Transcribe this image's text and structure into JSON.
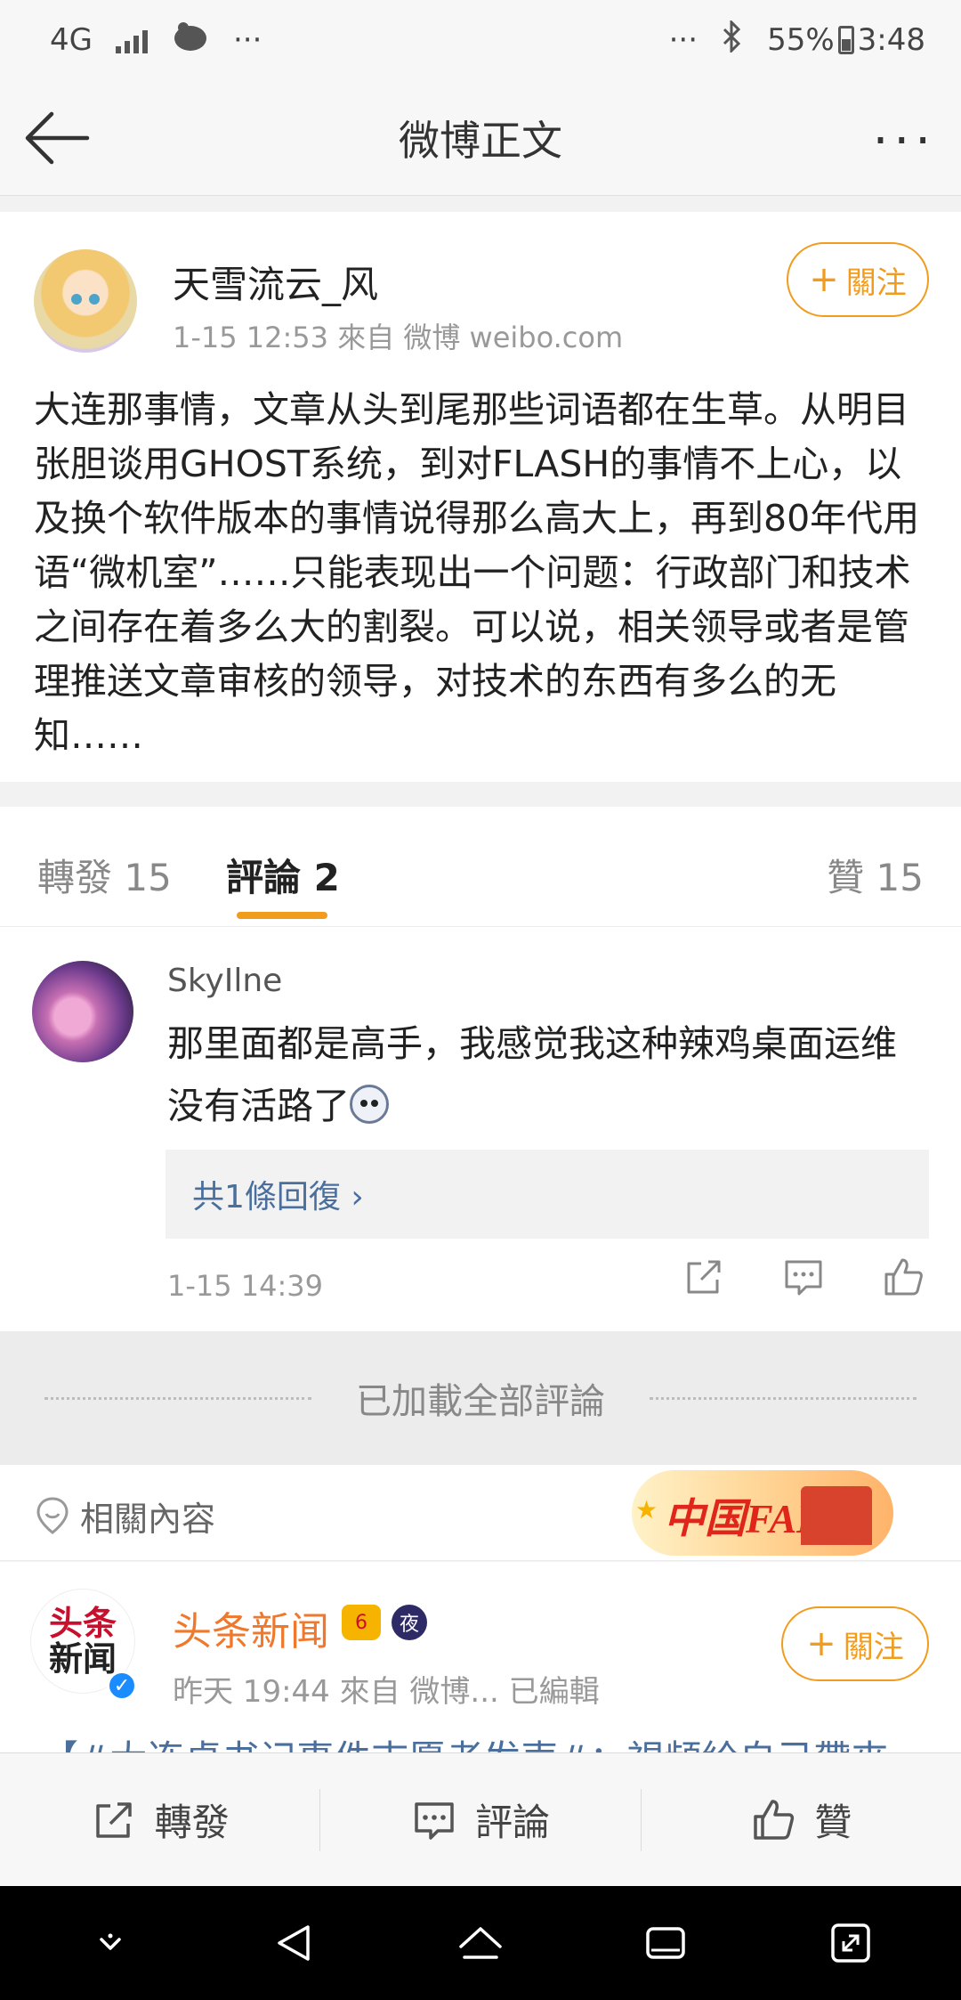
{
  "status_bar": {
    "network": "4G",
    "more_left": "···",
    "more_right": "···",
    "battery": "55%",
    "time": "3:48"
  },
  "nav": {
    "title": "微博正文",
    "more": "···"
  },
  "post": {
    "author": "天雪流云_风",
    "meta": "1-15 12:53   來自 微博 weibo.com",
    "follow_label": "關注",
    "follow_plus": "+",
    "text": "大连那事情，文章从头到尾那些词语都在生草。从明目张胆谈用GHOST系统，到对FLASH的事情不上心，以及换个软件版本的事情说得那么高大上，再到80年代用语“微机室”……只能表现出一个问题：行政部门和技术之间存在着多么大的割裂。可以说，相关领导或者是管理推送文章审核的领导，对技术的东西有多么的无知……"
  },
  "tabs": {
    "repost": "轉發 15",
    "comment": "評論 2",
    "like": "贊 15"
  },
  "comment": {
    "user": "SkyIlne",
    "text": "那里面都是高手，我感觉我这种辣鸡桌面运维没有活路了",
    "replies": "共1條回復 ›",
    "time": "1-15 14:39"
  },
  "loaded_label": "已加載全部評論",
  "related": {
    "label": "相關內容",
    "badge_text": "中国FANS"
  },
  "news": {
    "avatar_line1": "头条",
    "avatar_line2": "新闻",
    "author": "头条新闻",
    "crown_badge": "6",
    "night_badge": "夜",
    "meta": "昨天 19:44   來自 微博...   已編輯",
    "follow_label": "關注",
    "follow_plus": "+",
    "peek": "【#大连桌书记事件志愿者发声#：視頻給自己帶來"
  },
  "action_bar": {
    "repost": "轉發",
    "comment": "評論",
    "like": "贊"
  },
  "colors": {
    "accent": "#f29c1f",
    "link": "#4a6f9c",
    "news_author": "#f0782c"
  }
}
